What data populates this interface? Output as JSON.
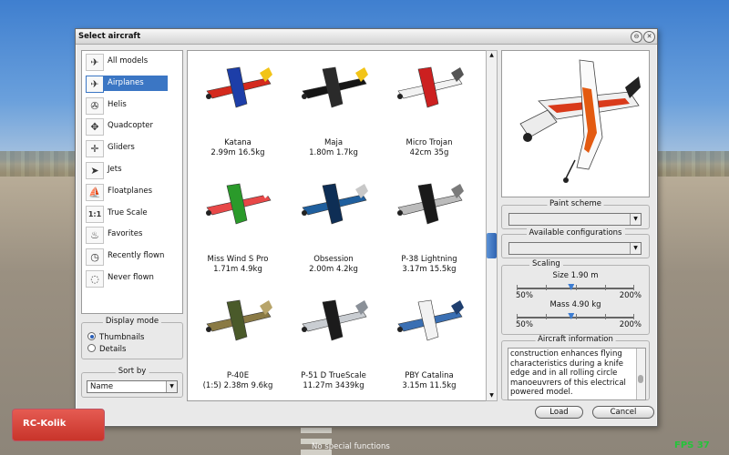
{
  "window": {
    "title": "Select aircraft"
  },
  "categories": [
    {
      "label": "All models",
      "icon": "all-models-icon",
      "glyph": "✈"
    },
    {
      "label": "Airplanes",
      "icon": "airplane-icon",
      "glyph": "✈",
      "selected": true
    },
    {
      "label": "Helis",
      "icon": "helicopter-icon",
      "glyph": "✇"
    },
    {
      "label": "Quadcopter",
      "icon": "quadcopter-icon",
      "glyph": "✥"
    },
    {
      "label": "Gliders",
      "icon": "glider-icon",
      "glyph": "✛"
    },
    {
      "label": "Jets",
      "icon": "jet-icon",
      "glyph": "➤"
    },
    {
      "label": "Floatplanes",
      "icon": "floatplane-icon",
      "glyph": "⛵"
    },
    {
      "label": "True Scale",
      "icon": "true-scale-icon",
      "glyph": "1:1"
    },
    {
      "label": "Favorites",
      "icon": "flame-icon",
      "glyph": "♨"
    },
    {
      "label": "Recently flown",
      "icon": "clock-icon",
      "glyph": "◷"
    },
    {
      "label": "Never flown",
      "icon": "dashed-clock-icon",
      "glyph": "◌"
    }
  ],
  "display_mode": {
    "title": "Display mode",
    "options": [
      {
        "label": "Thumbnails",
        "checked": true
      },
      {
        "label": "Details",
        "checked": false
      }
    ]
  },
  "sort": {
    "title": "Sort by",
    "value": "Name"
  },
  "aircraft": [
    {
      "name": "Katana",
      "specs": "2.99m 16.5kg",
      "colors": [
        "#d42a1e",
        "#1d3ea8",
        "#f2c418"
      ]
    },
    {
      "name": "Maja",
      "specs": "1.80m 1.7kg",
      "colors": [
        "#151515",
        "#2a2a2a",
        "#f2c418"
      ]
    },
    {
      "name": "Micro Trojan",
      "specs": "42cm 35g",
      "colors": [
        "#f2f2f2",
        "#cc2020",
        "#555555"
      ]
    },
    {
      "name": "Miss Wind S Pro",
      "specs": "1.71m 4.9kg",
      "colors": [
        "#e84848",
        "#2a9a2a",
        "#ffffff"
      ]
    },
    {
      "name": "Obsession",
      "specs": "2.00m 4.2kg",
      "colors": [
        "#1f5f9e",
        "#0e2e55",
        "#c8c8c8"
      ]
    },
    {
      "name": "P-38 Lightning",
      "specs": "3.17m 15.5kg",
      "colors": [
        "#bcbcbc",
        "#1a1a1a",
        "#7a7a7a"
      ]
    },
    {
      "name": "P-40E",
      "specs": "(1:5) 2.38m 9.6kg",
      "colors": [
        "#8a7a45",
        "#4a5a2a",
        "#b7a46a"
      ]
    },
    {
      "name": "P-51 D TrueScale",
      "specs": "11.27m 3439kg",
      "colors": [
        "#c9cdd2",
        "#1b1b1b",
        "#8a9098"
      ]
    },
    {
      "name": "PBY Catalina",
      "specs": "3.15m 11.5kg",
      "colors": [
        "#3a6fb3",
        "#f2f2f2",
        "#1f3f6f"
      ]
    }
  ],
  "details": {
    "paint_scheme": {
      "title": "Paint scheme",
      "value": ""
    },
    "configurations": {
      "title": "Available configurations",
      "value": ""
    },
    "scaling": {
      "title": "Scaling",
      "size_label": "Size 1.90 m",
      "size_level": 0.46,
      "mass_label": "Mass 4.90 kg",
      "mass_level": 0.46,
      "min_label": "50%",
      "max_label": "200%"
    },
    "info": {
      "title": "Aircraft information",
      "text": "construction enhances flying characteristics during a knife edge and in all rolling circle manoeuvrers of this electrical powered model."
    }
  },
  "buttons": {
    "load": "Load",
    "cancel": "Cancel"
  },
  "overlay": {
    "logo": "RC-Kolik",
    "fps": "FPS 37",
    "status": "No special functions"
  }
}
